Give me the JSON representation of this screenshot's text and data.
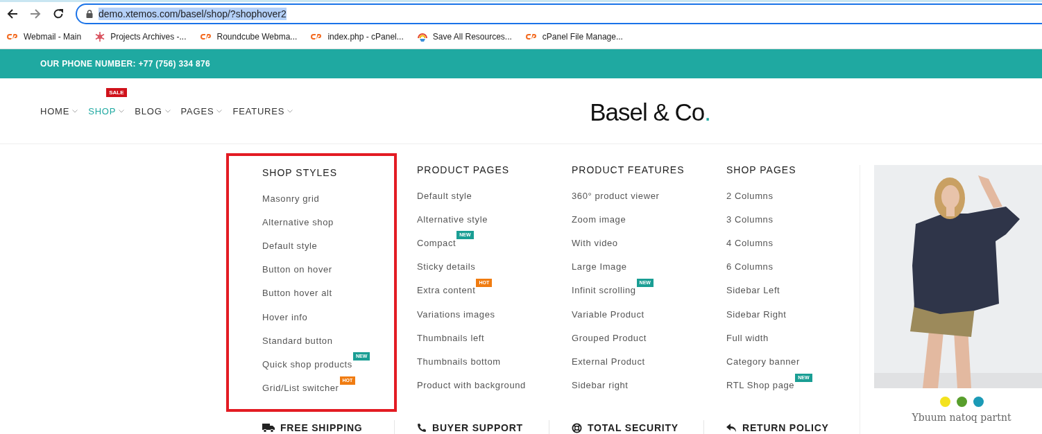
{
  "browser": {
    "url": "demo.xtemos.com/basel/shop/?shophover2",
    "url_selected": true,
    "bookmarks": [
      {
        "label": "Webmail - Main",
        "kind": "cpanel"
      },
      {
        "label": "Projects Archives -...",
        "kind": "snowflake"
      },
      {
        "label": "Roundcube Webma...",
        "kind": "cpanel"
      },
      {
        "label": "index.php - cPanel...",
        "kind": "cpanel"
      },
      {
        "label": "Save All Resources...",
        "kind": "rainbow"
      },
      {
        "label": "cPanel File Manage...",
        "kind": "cpanel"
      }
    ]
  },
  "topbar": {
    "phone": "OUR PHONE NUMBER: +77 (756) 334 876"
  },
  "nav": [
    {
      "label": "HOME",
      "selected": false
    },
    {
      "label": "SHOP",
      "selected": true,
      "badge": {
        "text": "SALE",
        "color": "#d0121b"
      }
    },
    {
      "label": "BLOG",
      "selected": false
    },
    {
      "label": "PAGES",
      "selected": false
    },
    {
      "label": "FEATURES",
      "selected": false
    }
  ],
  "logo": {
    "text": "Basel & Co",
    "accent": "."
  },
  "mega_menu": {
    "columns": [
      {
        "title": "SHOP STYLES",
        "highlighted": true,
        "items": [
          {
            "label": "Masonry grid"
          },
          {
            "label": "Alternative shop"
          },
          {
            "label": "Default style"
          },
          {
            "label": "Button on hover"
          },
          {
            "label": "Button hover alt"
          },
          {
            "label": "Hover info"
          },
          {
            "label": "Standard button"
          },
          {
            "label": "Quick shop products",
            "badge": {
              "text": "NEW",
              "color": "#1a9e94"
            }
          },
          {
            "label": "Grid/List switcher",
            "badge": {
              "text": "HOT",
              "color": "#f07c11"
            }
          }
        ]
      },
      {
        "title": "PRODUCT PAGES",
        "highlighted": false,
        "items": [
          {
            "label": "Default style"
          },
          {
            "label": "Alternative style"
          },
          {
            "label": "Compact",
            "badge": {
              "text": "NEW",
              "color": "#1a9e94"
            }
          },
          {
            "label": "Sticky details"
          },
          {
            "label": "Extra content",
            "badge": {
              "text": "HOT",
              "color": "#f07c11"
            }
          },
          {
            "label": "Variations images"
          },
          {
            "label": "Thumbnails left"
          },
          {
            "label": "Thumbnails bottom"
          },
          {
            "label": "Product with background"
          }
        ]
      },
      {
        "title": "PRODUCT FEATURES",
        "highlighted": false,
        "items": [
          {
            "label": "360° product viewer"
          },
          {
            "label": "Zoom image"
          },
          {
            "label": "With video"
          },
          {
            "label": "Large Image"
          },
          {
            "label": "Infinit scrolling",
            "badge": {
              "text": "NEW",
              "color": "#1a9e94"
            }
          },
          {
            "label": "Variable Product"
          },
          {
            "label": "Grouped Product"
          },
          {
            "label": "External Product"
          },
          {
            "label": "Sidebar right"
          }
        ]
      },
      {
        "title": "SHOP PAGES",
        "highlighted": false,
        "items": [
          {
            "label": "2 Columns"
          },
          {
            "label": "3 Columns"
          },
          {
            "label": "4 Columns"
          },
          {
            "label": "6 Columns"
          },
          {
            "label": "Sidebar Left"
          },
          {
            "label": "Sidebar Right"
          },
          {
            "label": "Full width"
          },
          {
            "label": "Category banner"
          },
          {
            "label": "RTL Shop page",
            "badge": {
              "text": "NEW",
              "color": "#1a9e94"
            }
          }
        ]
      }
    ],
    "product": {
      "kind": "picture",
      "name": "Ybuum natoq partnt",
      "swatches": [
        {
          "color": "#f3e21e"
        },
        {
          "color": "#589e2c"
        },
        {
          "color": "#1b9ab6"
        }
      ]
    }
  },
  "features": [
    {
      "label": "FREE SHIPPING",
      "kind": "truck"
    },
    {
      "label": "BUYER SUPPORT",
      "kind": "phone"
    },
    {
      "label": "TOTAL SECURITY",
      "kind": "lifebuoy"
    },
    {
      "label": "RETURN POLICY",
      "kind": "return"
    }
  ]
}
